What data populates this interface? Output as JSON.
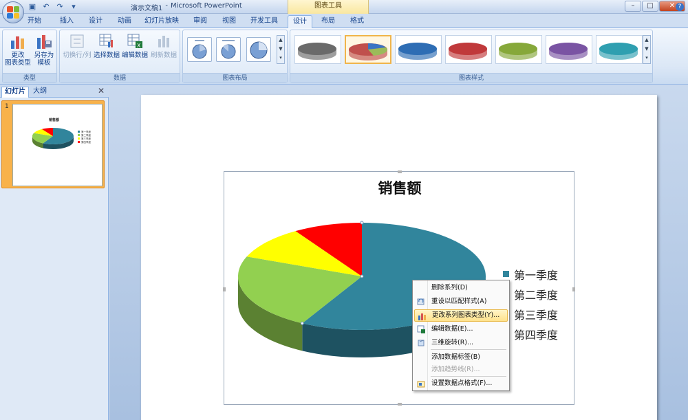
{
  "window": {
    "doc_name": "演示文稿1",
    "separator": "-",
    "app_name": "Microsoft PowerPoint",
    "context_tools": "图表工具"
  },
  "tabs": [
    "开始",
    "插入",
    "设计",
    "动画",
    "幻灯片放映",
    "审阅",
    "视图",
    "开发工具",
    "设计",
    "布局",
    "格式"
  ],
  "active_tab_index": 8,
  "ribbon": {
    "group_type": {
      "label": "类型",
      "change_chart_type": "更改\n图表类型",
      "save_as_template": "另存为\n模板"
    },
    "group_data": {
      "label": "数据",
      "switch_row_col": "切换行/列",
      "select_data": "选择数据",
      "edit_data": "编辑数据",
      "refresh_data": "刷新数据"
    },
    "group_layout": {
      "label": "图表布局"
    },
    "group_styles": {
      "label": "图表样式",
      "swatches": [
        "#6a6a6a",
        "#c0504d",
        "#2e6db4",
        "#c0393b",
        "#86a83a",
        "#7a54a3",
        "#2f9fb0"
      ],
      "selected_index": 1
    }
  },
  "left_panel": {
    "tab_slides": "幻灯片",
    "tab_outline": "大纲",
    "slide_number": "1"
  },
  "chart_data": {
    "type": "pie",
    "title": "销售额",
    "categories": [
      "第一季度",
      "第二季度",
      "第三季度",
      "第四季度"
    ],
    "values": [
      58,
      23,
      10,
      9
    ],
    "colors": [
      "#31859c",
      "#92d050",
      "#ffff00",
      "#ff0000"
    ],
    "legend_position": "right"
  },
  "context_menu": {
    "items": [
      {
        "label": "删除系列(D)",
        "icon": "none",
        "disabled": false
      },
      {
        "label": "重设以匹配样式(A)",
        "icon": "reset-icon",
        "disabled": false
      },
      {
        "label": "更改系列图表类型(Y)...",
        "icon": "chart-type-icon",
        "disabled": false,
        "hover": true
      },
      {
        "label": "编辑数据(E)...",
        "icon": "edit-data-icon",
        "disabled": false
      },
      {
        "label": "三维旋转(R)...",
        "icon": "rotate-3d-icon",
        "disabled": false
      },
      {
        "label": "添加数据标签(B)",
        "icon": "none",
        "disabled": false
      },
      {
        "label": "添加趋势线(R)...",
        "icon": "none",
        "disabled": true
      },
      {
        "label": "设置数据点格式(F)...",
        "icon": "format-icon",
        "disabled": false
      }
    ]
  }
}
